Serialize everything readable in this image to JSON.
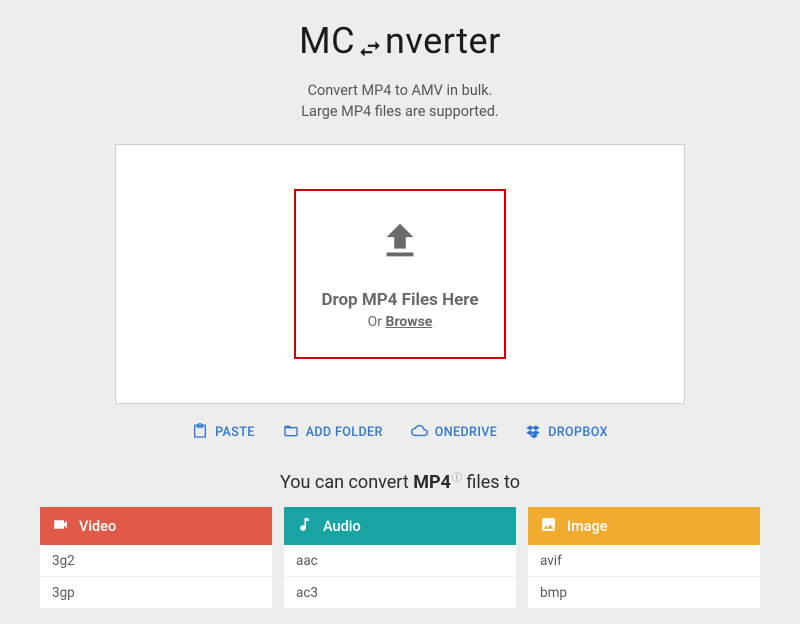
{
  "logo": {
    "prefix": "MC",
    "suffix": "nverter"
  },
  "subtitle_line1": "Convert MP4 to AMV in bulk.",
  "subtitle_line2": "Large MP4 files are supported.",
  "drop": {
    "title": "Drop MP4 Files Here",
    "or": "Or ",
    "browse": "Browse"
  },
  "actions": {
    "paste": "PASTE",
    "add_folder": "ADD FOLDER",
    "onedrive": "ONEDRIVE",
    "dropbox": "DROPBOX"
  },
  "convert": {
    "lead": "You can convert ",
    "format": "MP4",
    "tail": " files to"
  },
  "columns": {
    "video": {
      "title": "Video",
      "items": [
        "3g2",
        "3gp"
      ]
    },
    "audio": {
      "title": "Audio",
      "items": [
        "aac",
        "ac3"
      ]
    },
    "image": {
      "title": "Image",
      "items": [
        "avif",
        "bmp"
      ]
    }
  }
}
